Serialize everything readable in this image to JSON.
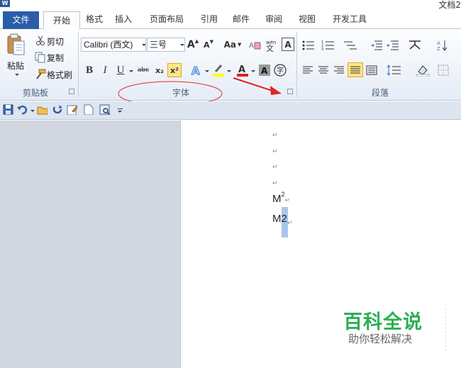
{
  "window": {
    "title": "文档2"
  },
  "tabs": [
    "文件",
    "开始",
    "格式",
    "插入",
    "页面布局",
    "引用",
    "邮件",
    "审阅",
    "视图",
    "开发工具"
  ],
  "clipboard": {
    "paste_label": "粘贴",
    "cut_label": "剪切",
    "copy_label": "复制",
    "format_painter_label": "格式刷",
    "group_label": "剪贴板"
  },
  "font": {
    "font_name": "Calibri (西文)",
    "font_size": "三号",
    "bold": "B",
    "italic": "I",
    "underline": "U",
    "strikethrough": "abc",
    "subscript": "x₂",
    "superscript": "x²",
    "change_case": "Aa",
    "grow": "A",
    "shrink": "A",
    "group_label": "字体",
    "highlight_color": "#ffff00",
    "font_color": "#e02020"
  },
  "paragraph": {
    "group_label": "段落"
  },
  "document": {
    "lines": [
      "M",
      "M2"
    ],
    "superscript_text": "2",
    "empty_paragraphs": 4
  },
  "watermark": {
    "title": "百科全说",
    "subtitle": "助你轻松解决"
  },
  "annotation": {
    "ellipse_color": "#e25252",
    "arrow_color": "#e02424"
  },
  "colors": {
    "file_tab": "#2a5ea8",
    "ribbon_border": "#b8c6d8",
    "workspace": "#d1d6df"
  }
}
